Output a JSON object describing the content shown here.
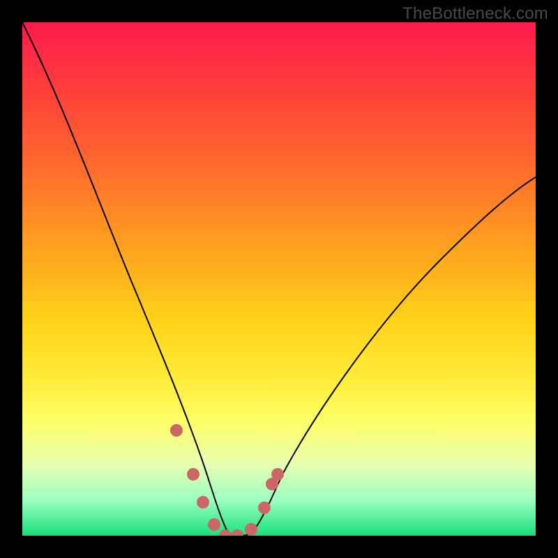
{
  "watermark": "TheBottleneck.com",
  "chart_data": {
    "type": "line",
    "title": "",
    "xlabel": "",
    "ylabel": "",
    "xlim": [
      0,
      1
    ],
    "ylim": [
      0,
      1
    ],
    "grid": false,
    "series": [
      {
        "name": "curve",
        "color": "#000000",
        "x": [
          0.0,
          0.04,
          0.08,
          0.12,
          0.16,
          0.2,
          0.24,
          0.28,
          0.32,
          0.36,
          0.38,
          0.4,
          0.42,
          0.44,
          0.46,
          0.48,
          0.5,
          0.56,
          0.62,
          0.68,
          0.74,
          0.8,
          0.86,
          0.92,
          1.0
        ],
        "y": [
          1.0,
          0.89,
          0.79,
          0.69,
          0.58,
          0.48,
          0.37,
          0.25,
          0.14,
          0.05,
          0.02,
          0.0,
          0.0,
          0.0,
          0.02,
          0.05,
          0.09,
          0.17,
          0.25,
          0.33,
          0.4,
          0.47,
          0.53,
          0.58,
          0.64
        ]
      },
      {
        "name": "markers",
        "color": "#cc6666",
        "x": [
          0.3,
          0.333,
          0.352,
          0.374,
          0.396,
          0.418,
          0.445,
          0.472,
          0.486,
          0.497
        ],
        "y": [
          0.205,
          0.12,
          0.065,
          0.022,
          0.0,
          0.0,
          0.012,
          0.055,
          0.1,
          0.12
        ]
      }
    ],
    "background_gradient": {
      "top": "#ff1a4d",
      "bottom": "#18e07c"
    }
  }
}
